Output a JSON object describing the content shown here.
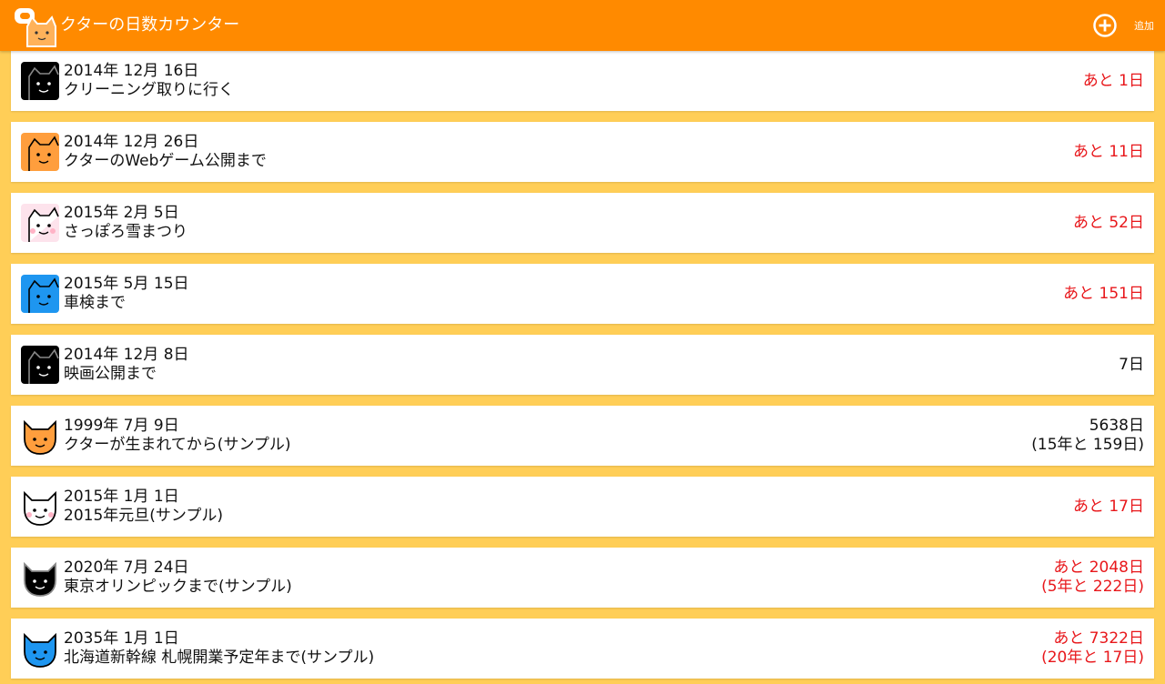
{
  "app": {
    "title": "クターの日数カウンター",
    "add_label": "追加"
  },
  "colors": {
    "app_bar": "#FF8A00",
    "background": "#FFCE57",
    "future": "#E8171B",
    "past": "#111111"
  },
  "events": [
    {
      "date": "2014年 12月 16日",
      "title": "クリーニング取りに行く",
      "count": "あと 1日",
      "count2": "",
      "status": "future",
      "icon": "black-cat-icon"
    },
    {
      "date": "2014年 12月 26日",
      "title": "クターのWebゲーム公開まで",
      "count": "あと 11日",
      "count2": "",
      "status": "future",
      "icon": "orange-cat-icon"
    },
    {
      "date": "2015年 2月 5日",
      "title": "さっぽろ雪まつり",
      "count": "あと 52日",
      "count2": "",
      "status": "future",
      "icon": "white-cat-icon"
    },
    {
      "date": "2015年 5月 15日",
      "title": "車検まで",
      "count": "あと 151日",
      "count2": "",
      "status": "future",
      "icon": "blue-cat-icon"
    },
    {
      "date": "2014年 12月 8日",
      "title": "映画公開まで",
      "count": "7日",
      "count2": "",
      "status": "past",
      "icon": "black-cat-icon"
    },
    {
      "date": "1999年 7月 9日",
      "title": "クターが生まれてから(サンプル)",
      "count": "5638日",
      "count2": "(15年と 159日)",
      "status": "past",
      "icon": "orange-cat-face-icon"
    },
    {
      "date": "2015年 1月 1日",
      "title": "2015年元旦(サンプル)",
      "count": "あと 17日",
      "count2": "",
      "status": "future",
      "icon": "white-cat-face-icon"
    },
    {
      "date": "2020年 7月 24日",
      "title": "東京オリンピックまで(サンプル)",
      "count": "あと 2048日",
      "count2": "(5年と 222日)",
      "status": "future",
      "icon": "black-cat-face-icon"
    },
    {
      "date": "2035年 1月 1日",
      "title": "北海道新幹線 札幌開業予定年まで(サンプル)",
      "count": "あと 7322日",
      "count2": "(20年と 17日)",
      "status": "future",
      "icon": "blue-cat-face-icon"
    }
  ]
}
